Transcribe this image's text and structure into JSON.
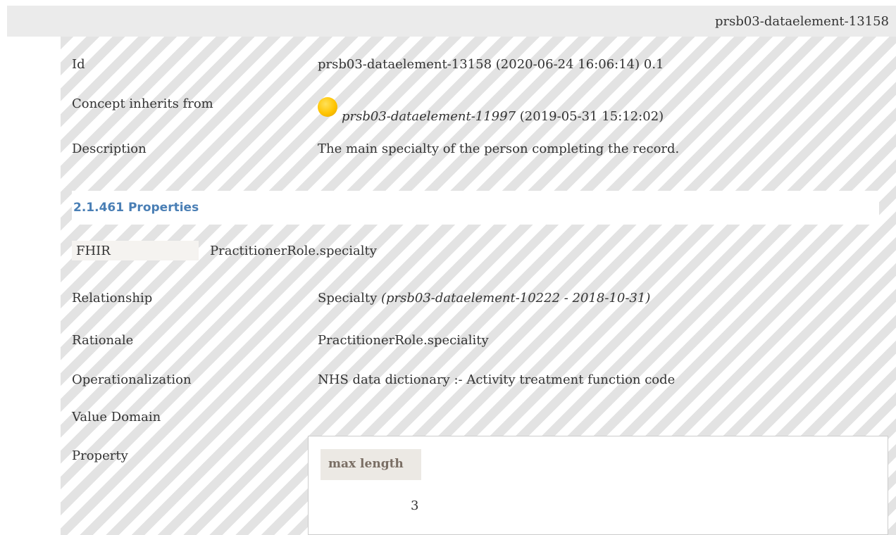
{
  "header": {
    "element_id": "prsb03-dataelement-13158"
  },
  "details": {
    "id": {
      "label": "Id",
      "value": "prsb03-dataelement-13158 (2020-06-24 16:06:14) 0.1"
    },
    "inherits": {
      "label": "Concept inherits from",
      "ref": "prsb03-dataelement-11997",
      "date": "(2019-05-31 15:12:02)",
      "status_color": "#ffc400"
    },
    "description": {
      "label": "Description",
      "value": "The main specialty of the person completing the record."
    }
  },
  "properties_section": {
    "title": "2.1.461 Properties"
  },
  "fhir": {
    "label": "FHIR",
    "value": "PractitionerRole.specialty"
  },
  "relationship": {
    "label": "Relationship",
    "value": "Specialty",
    "detail": "(prsb03-dataelement-10222 - 2018-10-31)"
  },
  "rationale": {
    "label": "Rationale",
    "value": "PractitionerRole.speciality"
  },
  "operationalization": {
    "label": "Operationalization",
    "value": "NHS data dictionary :- Activity treatment function code"
  },
  "value_domain": {
    "label": "Value Domain"
  },
  "property": {
    "label": "Property",
    "column_header": "max length",
    "column_value": "3"
  },
  "colors": {
    "section_title": "#4a7fb5",
    "header_bar": "#ebebeb",
    "stripe": "#e3e3e3"
  }
}
